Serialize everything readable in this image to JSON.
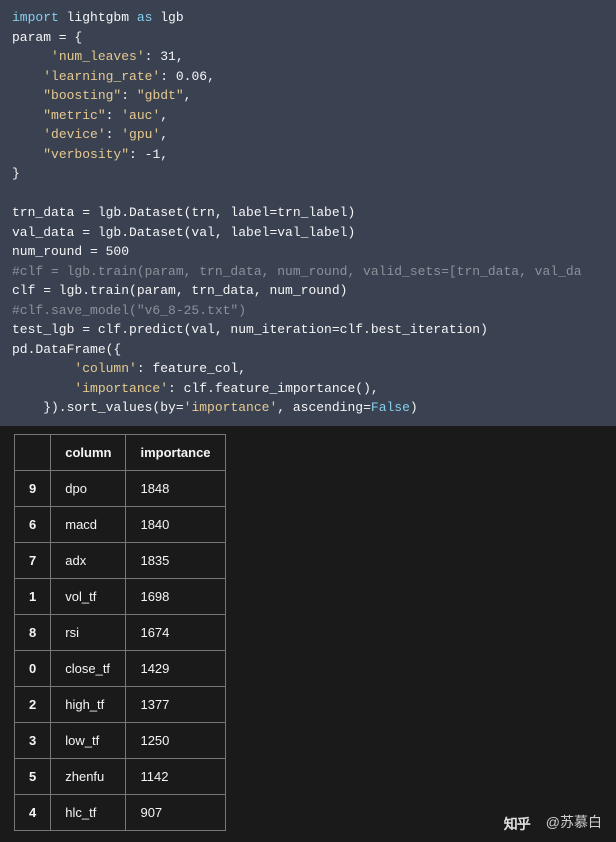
{
  "code_lines": [
    {
      "raw": "import lightgbm as lgb"
    },
    {
      "raw": "param = {"
    },
    {
      "raw": "     'num_leaves': 31,"
    },
    {
      "raw": "    'learning_rate': 0.06,"
    },
    {
      "raw": "    \"boosting\": \"gbdt\","
    },
    {
      "raw": "    \"metric\": 'auc',"
    },
    {
      "raw": "    'device': 'gpu',"
    },
    {
      "raw": "    \"verbosity\": -1,"
    },
    {
      "raw": "}"
    },
    {
      "raw": ""
    },
    {
      "raw": "trn_data = lgb.Dataset(trn, label=trn_label)"
    },
    {
      "raw": "val_data = lgb.Dataset(val, label=val_label)"
    },
    {
      "raw": "num_round = 500"
    },
    {
      "raw": "#clf = lgb.train(param, trn_data, num_round, valid_sets=[trn_data, val_da"
    },
    {
      "raw": "clf = lgb.train(param, trn_data, num_round)"
    },
    {
      "raw": "#clf.save_model(\"v6_8-25.txt\")"
    },
    {
      "raw": "test_lgb = clf.predict(val, num_iteration=clf.best_iteration)"
    },
    {
      "raw": "pd.DataFrame({"
    },
    {
      "raw": "        'column': feature_col,"
    },
    {
      "raw": "        'importance': clf.feature_importance(),"
    },
    {
      "raw": "    }).sort_values(by='importance', ascending=False)"
    }
  ],
  "table": {
    "headers": [
      "",
      "column",
      "importance"
    ],
    "rows": [
      {
        "idx": "9",
        "column": "dpo",
        "importance": "1848"
      },
      {
        "idx": "6",
        "column": "macd",
        "importance": "1840"
      },
      {
        "idx": "7",
        "column": "adx",
        "importance": "1835"
      },
      {
        "idx": "1",
        "column": "vol_tf",
        "importance": "1698"
      },
      {
        "idx": "8",
        "column": "rsi",
        "importance": "1674"
      },
      {
        "idx": "0",
        "column": "close_tf",
        "importance": "1429"
      },
      {
        "idx": "2",
        "column": "high_tf",
        "importance": "1377"
      },
      {
        "idx": "3",
        "column": "low_tf",
        "importance": "1250"
      },
      {
        "idx": "5",
        "column": "zhenfu",
        "importance": "1142"
      },
      {
        "idx": "4",
        "column": "hlc_tf",
        "importance": "907"
      }
    ]
  },
  "watermark": {
    "logo": "知乎",
    "author": "@苏慕白"
  }
}
